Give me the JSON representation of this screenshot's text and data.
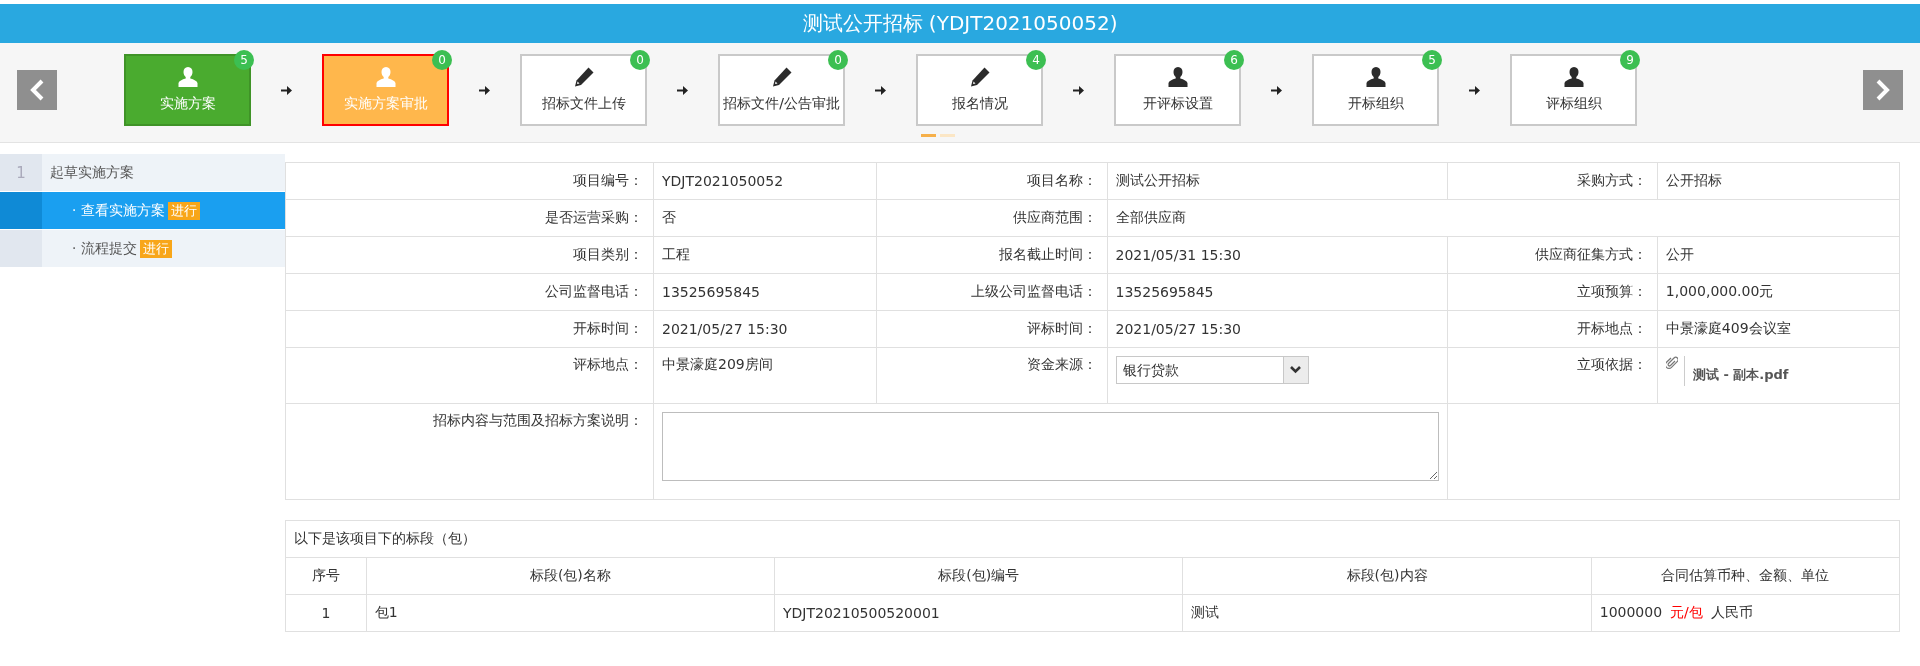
{
  "title": "测试公开招标 (YDJT2021050052)",
  "steps": [
    {
      "label": "实施方案",
      "count": "5",
      "kind": "person",
      "completed": true,
      "selected": false
    },
    {
      "label": "实施方案审批",
      "count": "0",
      "kind": "person",
      "completed": false,
      "selected": true
    },
    {
      "label": "招标文件上传",
      "count": "0",
      "kind": "pencil",
      "completed": false,
      "selected": false
    },
    {
      "label": "招标文件/公告审批",
      "count": "0",
      "kind": "pencil",
      "completed": false,
      "selected": false
    },
    {
      "label": "报名情况",
      "count": "4",
      "kind": "pencil",
      "completed": false,
      "selected": false
    },
    {
      "label": "开评标设置",
      "count": "6",
      "kind": "person",
      "completed": false,
      "selected": false
    },
    {
      "label": "开标组织",
      "count": "5",
      "kind": "person",
      "completed": false,
      "selected": false
    },
    {
      "label": "评标组织",
      "count": "9",
      "kind": "person",
      "completed": false,
      "selected": false
    }
  ],
  "pager": [
    {
      "selected": true
    },
    {
      "selected": false
    }
  ],
  "sidebar": {
    "groups": [
      {
        "number": "1",
        "label": "起草实施方案",
        "items": [
          {
            "label": "· 查看实施方案",
            "tag": "进行",
            "selected": true
          },
          {
            "label": "· 流程提交",
            "tag": "进行",
            "selected": false
          }
        ]
      }
    ]
  },
  "form": {
    "rows": [
      [
        {
          "kind": "text",
          "label": "项目编号：",
          "value": "YDJT2021050052"
        },
        {
          "kind": "text",
          "label": "项目名称：",
          "value": "测试公开招标"
        },
        {
          "kind": "text",
          "label": "采购方式：",
          "value": "公开招标"
        }
      ],
      [
        {
          "kind": "text",
          "label": "是否运营采购：",
          "value": "否"
        },
        {
          "kind": "text",
          "label": "供应商范围：",
          "value": "全部供应商"
        }
      ],
      [
        {
          "kind": "text",
          "label": "项目类别：",
          "value": "工程"
        },
        {
          "kind": "text",
          "label": "报名截止时间：",
          "value": "2021/05/31 15:30"
        },
        {
          "kind": "text",
          "label": "供应商征集方式：",
          "value": "公开"
        }
      ],
      [
        {
          "kind": "text",
          "label": "公司监督电话：",
          "value": "13525695845"
        },
        {
          "kind": "text",
          "label": "上级公司监督电话：",
          "value": "13525695845"
        },
        {
          "kind": "text",
          "label": "立项预算：",
          "value": "1,000,000.00元"
        }
      ],
      [
        {
          "kind": "text",
          "label": "开标时间：",
          "value": "2021/05/27 15:30"
        },
        {
          "kind": "text",
          "label": "评标时间：",
          "value": "2021/05/27 15:30"
        },
        {
          "kind": "text",
          "label": "开标地点：",
          "value": "中景濠庭409会议室"
        }
      ],
      [
        {
          "kind": "text",
          "label": "评标地点：",
          "value": "中景濠庭209房间"
        },
        {
          "kind": "select",
          "label": "资金来源：",
          "value": "银行贷款"
        },
        {
          "kind": "file",
          "label": "立项依据：",
          "value": "测试 - 副本.pdf"
        }
      ],
      [
        {
          "kind": "textarea",
          "label": "招标内容与范围及招标方案说明："
        }
      ]
    ]
  },
  "packages": {
    "caption": "以下是该项目下的标段（包）",
    "columns": [
      "序号",
      "标段(包)名称",
      "标段(包)编号",
      "标段(包)内容",
      "合同估算币种、金额、单位"
    ],
    "rows": [
      {
        "index": "1",
        "name": "包1",
        "code": "YDJT20210500520001",
        "content": "测试",
        "amount": "1000000",
        "unit": "元/包",
        "currency": "人民币"
      }
    ]
  }
}
